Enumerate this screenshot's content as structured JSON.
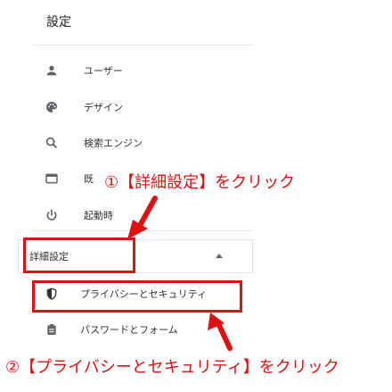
{
  "page": {
    "title": "設定"
  },
  "nav": {
    "items": [
      {
        "label": "ユーザー",
        "icon": "person-icon"
      },
      {
        "label": "デザイン",
        "icon": "palette-icon"
      },
      {
        "label": "検索エンジン",
        "icon": "search-icon"
      },
      {
        "label": "既",
        "icon": "browser-window-icon"
      },
      {
        "label": "起動時",
        "icon": "power-icon"
      }
    ],
    "advanced": {
      "label": "詳細設定",
      "expanded": true
    },
    "sub_items": [
      {
        "label": "プライバシーとセキュリティ",
        "icon": "shield-icon"
      },
      {
        "label": "パスワードとフォーム",
        "icon": "assignment-icon"
      }
    ]
  },
  "annotations": {
    "step1": "①【詳細設定】をクリック",
    "step2": "②【プライバシーとセキュリティ】をクリック",
    "color": "#e01010"
  },
  "colors": {
    "accent": "#e01010",
    "divider": "#e6e6e6",
    "icon": "#5f6368"
  }
}
